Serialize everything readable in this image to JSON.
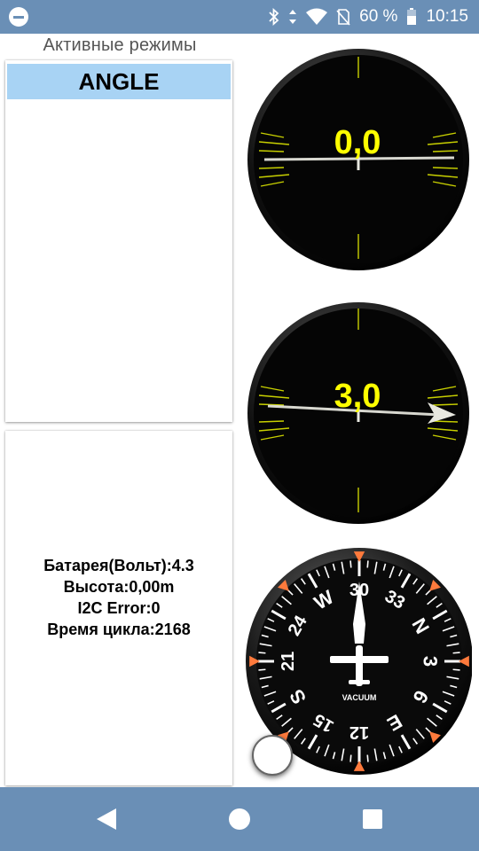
{
  "status_bar": {
    "battery_percent": "60 %",
    "time": "10:15",
    "icons": [
      "do-not-disturb-icon",
      "bluetooth-icon",
      "data-arrows-icon",
      "wifi-icon",
      "no-sim-icon",
      "battery-icon"
    ]
  },
  "modes": {
    "title": "Активные режимы",
    "items": [
      {
        "label": "ANGLE"
      }
    ]
  },
  "info": {
    "battery": "Батарея(Вольт):4.3",
    "altitude": "Высота:0,00m",
    "i2c_error": "I2C Error:0",
    "cycle_time": "Время цикла:2168"
  },
  "gauges": {
    "pitch": {
      "value": "0,0"
    },
    "roll": {
      "value": "3,0"
    },
    "heading": {
      "label": "VACUUM",
      "dial_labels": [
        "30",
        "33",
        "N",
        "3",
        "6",
        "E",
        "12",
        "15",
        "S",
        "21",
        "24",
        "W"
      ]
    }
  },
  "nav": {
    "icons": [
      "back-icon",
      "home-icon",
      "recents-icon"
    ]
  },
  "colors": {
    "status_bar": "#6a8fb6",
    "mode_highlight": "#a8d3f4",
    "gauge_value": "#ffff00"
  }
}
